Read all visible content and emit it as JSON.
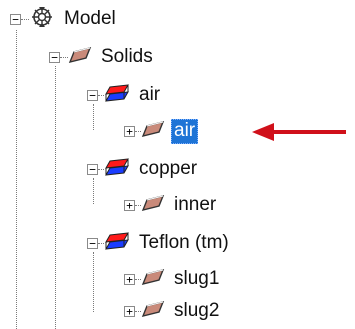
{
  "tree": {
    "root": {
      "label": "Model",
      "icon": "model-icon",
      "expanded": true
    },
    "solids": {
      "label": "Solids",
      "icon": "solid-icon",
      "expanded": true
    },
    "groups": [
      {
        "label": "air",
        "icon": "material-icon",
        "expanded": true,
        "color_top": "#ff1a1a",
        "color_bottom": "#1a3cff",
        "children": [
          {
            "label": "air",
            "icon": "solid-icon",
            "expanded": false,
            "selected": true
          }
        ]
      },
      {
        "label": "copper",
        "icon": "material-icon",
        "expanded": true,
        "color_top": "#ff1a1a",
        "color_bottom": "#1a3cff",
        "children": [
          {
            "label": "inner",
            "icon": "solid-icon",
            "expanded": false,
            "selected": false
          }
        ]
      },
      {
        "label": "Teflon (tm)",
        "icon": "material-icon",
        "expanded": true,
        "color_top": "#ff1a1a",
        "color_bottom": "#1a3cff",
        "children": [
          {
            "label": "slug1",
            "icon": "solid-icon",
            "expanded": false,
            "selected": false
          },
          {
            "label": "slug2",
            "icon": "solid-icon",
            "expanded": false,
            "selected": false
          }
        ]
      }
    ]
  },
  "annotation": {
    "icon": "red-arrow-icon",
    "color": "#d0101a"
  },
  "colors": {
    "selection": "#1e74d6",
    "solid_icon_fill": "#c98a7a"
  }
}
